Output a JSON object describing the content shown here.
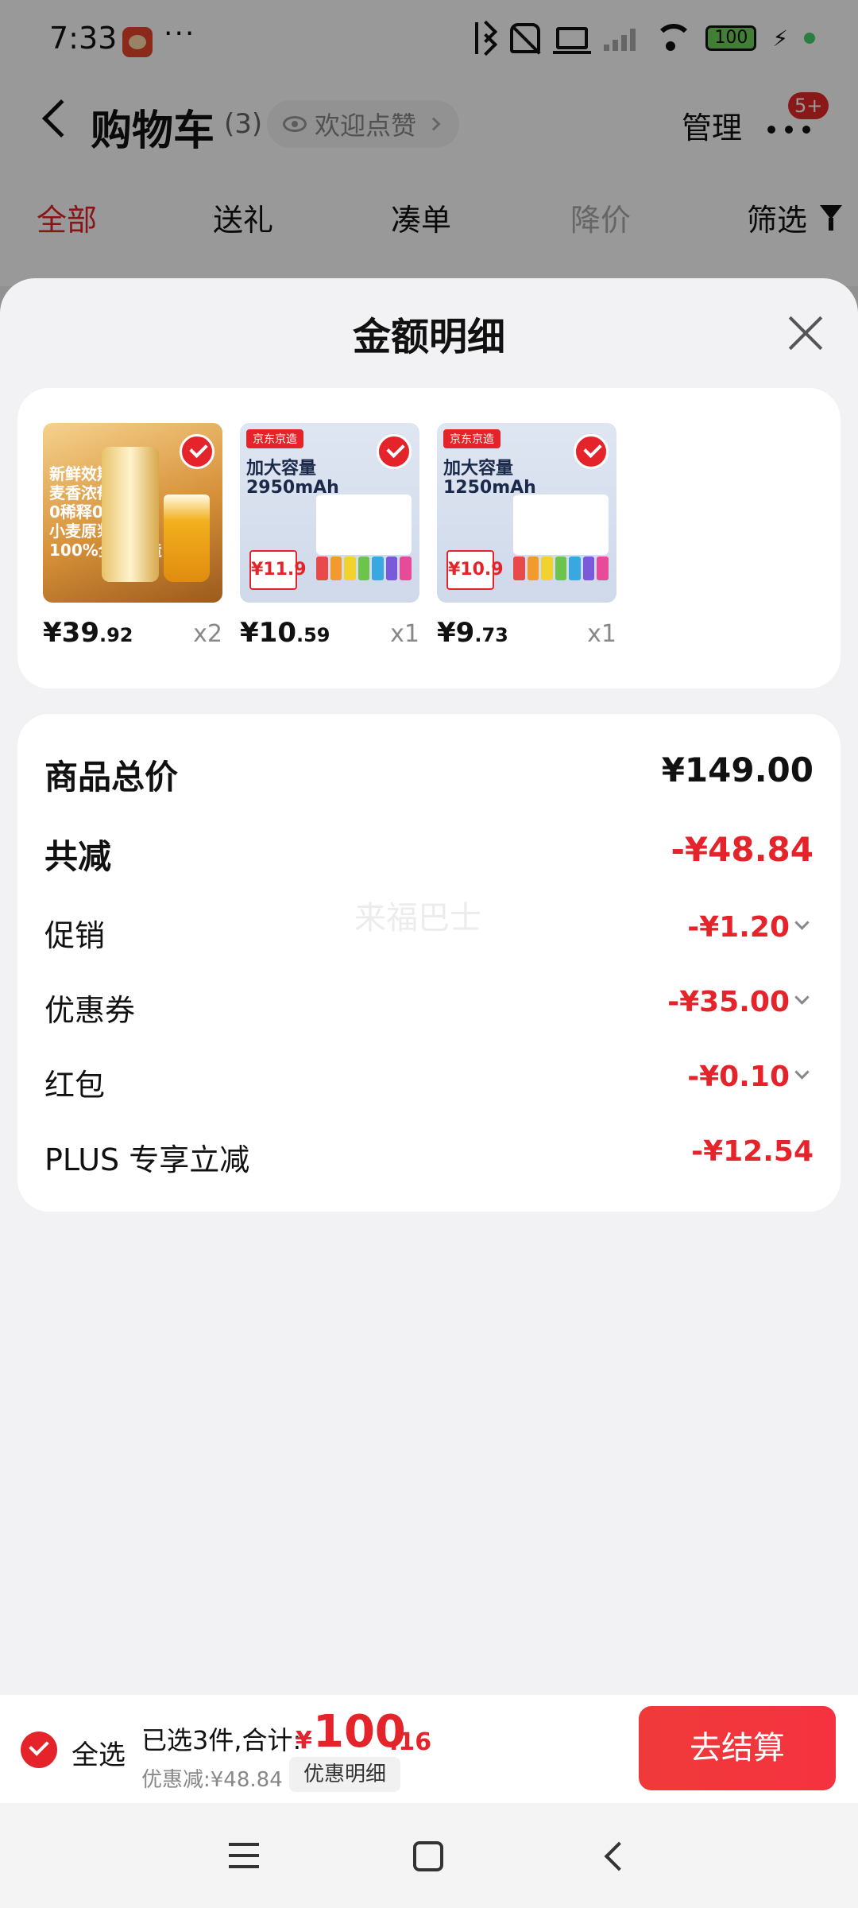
{
  "status_bar": {
    "time": "7:33",
    "more": "···",
    "battery": "100"
  },
  "header": {
    "title": "购物车",
    "count": "(3)",
    "like_pill": "欢迎点赞",
    "manage": "管理",
    "badge": "5+"
  },
  "tabs": [
    "全部",
    "送礼",
    "凑单",
    "降价",
    "筛选"
  ],
  "sheet": {
    "title": "金额明细",
    "products": [
      {
        "price_int": "¥39",
        "price_dec": ".92",
        "qty": "x2",
        "image_text": "新鲜效期\n麦香浓郁\n0稀释0勾兑\n小麦原浆13°P\n100%全麦酿造"
      },
      {
        "price_int": "¥10",
        "price_dec": ".59",
        "qty": "x1",
        "image_text": "加大容量\n2950mAh",
        "brand": "京东京造",
        "tag": "¥11.9"
      },
      {
        "price_int": "¥9",
        "price_dec": ".73",
        "qty": "x1",
        "image_text": "加大容量\n1250mAh",
        "brand": "京东京造",
        "tag": "¥10.9"
      }
    ],
    "summary": {
      "goods_total_label": "商品总价",
      "goods_total": "¥149.00",
      "total_reduction_label": "共减",
      "total_reduction": "-¥48.84",
      "promotion_label": "促销",
      "promotion": "-¥1.20",
      "coupon_label": "优惠券",
      "coupon": "-¥35.00",
      "red_packet_label": "红包",
      "red_packet": "-¥0.10",
      "plus_label": "PLUS 专享立减",
      "plus": "-¥12.54"
    },
    "watermark": "来福巴士"
  },
  "bottom_bar": {
    "select_all": "全选",
    "selected_summary": "已选3件,合计:",
    "currency": "¥",
    "total_int": "100",
    "total_dec": ".16",
    "discount_line": "优惠减:¥48.84",
    "detail_chip": "优惠明细",
    "checkout": "去结算"
  },
  "colors": {
    "accent": "#e4242a",
    "checkout": "#f03a3a",
    "sheet_bg": "#f2f2f4"
  }
}
